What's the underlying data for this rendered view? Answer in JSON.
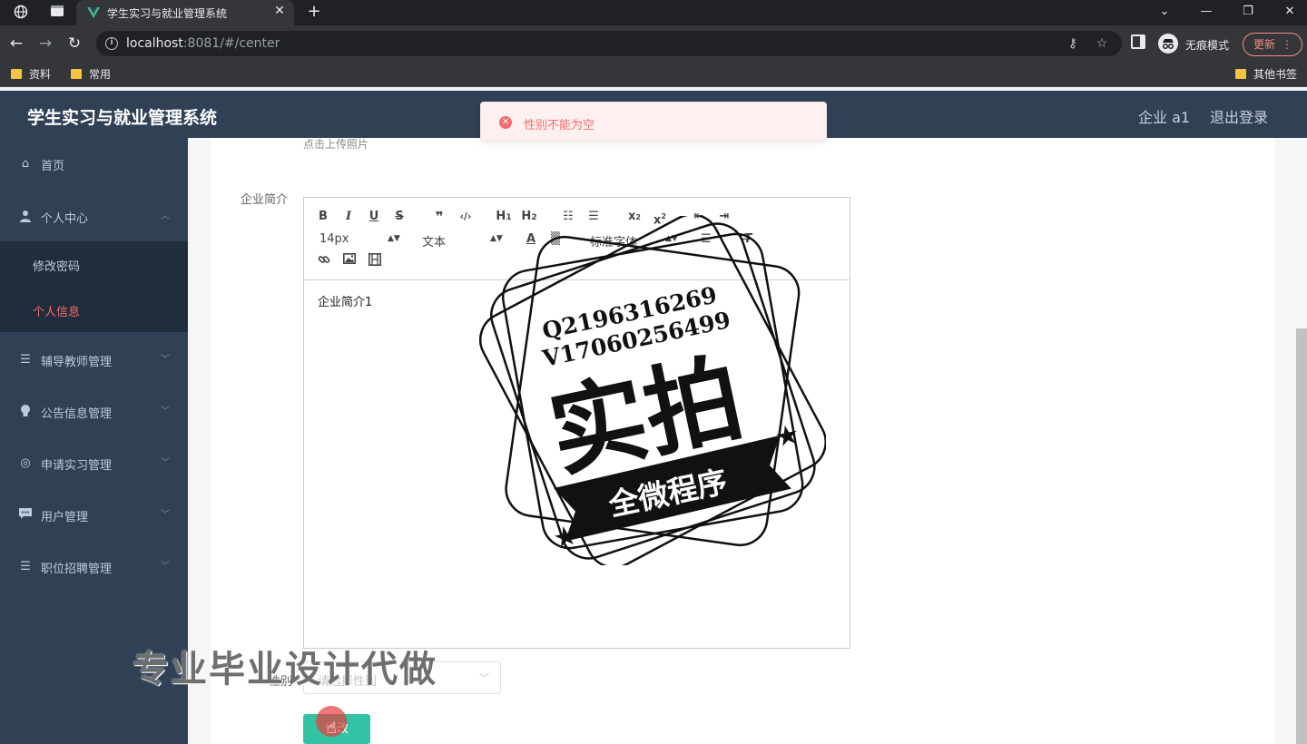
{
  "browser": {
    "tab_title": "学生实习与就业管理系统",
    "url_host": "localhost",
    "url_rest": ":8081/#/center",
    "incognito_label": "无痕模式",
    "update_label": "更新",
    "bookmarks": [
      "资料",
      "常用"
    ],
    "other_bookmarks": "其他书签"
  },
  "header": {
    "title": "学生实习与就业管理系统",
    "user": "企业 a1",
    "logout": "退出登录"
  },
  "sidebar": {
    "items": [
      {
        "label": "首页",
        "icon": "home-icon"
      },
      {
        "label": "个人中心",
        "icon": "user-icon"
      },
      {
        "label": "辅导教师管理",
        "icon": "list-icon"
      },
      {
        "label": "公告信息管理",
        "icon": "bulb-icon"
      },
      {
        "label": "申请实习管理",
        "icon": "target-icon"
      },
      {
        "label": "用户管理",
        "icon": "message-icon"
      },
      {
        "label": "职位招聘管理",
        "icon": "list-icon"
      }
    ],
    "submenu": [
      {
        "label": "修改密码"
      },
      {
        "label": "个人信息",
        "active": true
      }
    ]
  },
  "form": {
    "upload_tip": "点击上传照片",
    "intro_label": "企业简介",
    "editor": {
      "font_size": "14px",
      "block_format": "文本",
      "font_family": "标准字体",
      "content": "企业简介1"
    },
    "gender_label": "性别",
    "gender_placeholder": "请选择性别",
    "submit_label": "修改"
  },
  "toast": {
    "message": "性别不能为空",
    "color": "#f56c6c"
  },
  "watermark": {
    "contact_q": "Q2196316269",
    "contact_v": "V17060256499",
    "big": "实拍",
    "banner": "全微程序",
    "caption": "专业毕业设计代做"
  },
  "colors": {
    "sidebar_bg": "#304156",
    "active_menu": "#f56c6c",
    "primary_button": "#33c2a4"
  }
}
